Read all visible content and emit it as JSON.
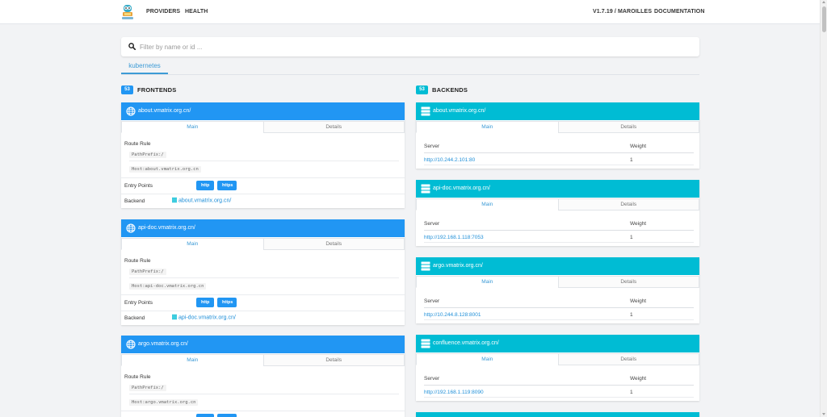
{
  "nav": {
    "links": [
      "PROVIDERS",
      "HEALTH"
    ],
    "version": "V1.7.19 / MAROILLES",
    "documentation": "DOCUMENTATION"
  },
  "search": {
    "placeholder": "Filter by name or id ..."
  },
  "provider_tab": "kubernetes",
  "colors": {
    "frontend": "#2196f3",
    "backend": "#00bcd4",
    "accent": "#3d9bd6"
  },
  "frontends": {
    "count": "53",
    "title": "FRONTENDS",
    "items": [
      {
        "name": "about.vmatrix.org.cn/",
        "tabs": [
          "Main",
          "Details"
        ],
        "route_rule_label": "Route Rule",
        "rules": [
          "PathPrefix:/",
          "Host:about.vmatrix.org.cn"
        ],
        "entry_points_label": "Entry Points",
        "entry_points": [
          "http",
          "https"
        ],
        "backend_label": "Backend",
        "backend": "about.vmatrix.org.cn/"
      },
      {
        "name": "api-doc.vmatrix.org.cn/",
        "tabs": [
          "Main",
          "Details"
        ],
        "route_rule_label": "Route Rule",
        "rules": [
          "PathPrefix:/",
          "Host:api-doc.vmatrix.org.cn"
        ],
        "entry_points_label": "Entry Points",
        "entry_points": [
          "http",
          "https"
        ],
        "backend_label": "Backend",
        "backend": "api-doc.vmatrix.org.cn/"
      },
      {
        "name": "argo.vmatrix.org.cn/",
        "tabs": [
          "Main",
          "Details"
        ],
        "route_rule_label": "Route Rule",
        "rules": [
          "PathPrefix:/",
          "Host:argo.vmatrix.org.cn"
        ]
      }
    ]
  },
  "backends": {
    "count": "53",
    "title": "BACKENDS",
    "items": [
      {
        "name": "about.vmatrix.org.cn/",
        "tabs": [
          "Main",
          "Details"
        ],
        "server_label": "Server",
        "weight_label": "Weight",
        "server": "http://10.244.2.101:80",
        "weight": "1"
      },
      {
        "name": "api-doc.vmatrix.org.cn/",
        "tabs": [
          "Main",
          "Details"
        ],
        "server_label": "Server",
        "weight_label": "Weight",
        "server": "http://192.168.1.118:7053",
        "weight": "1"
      },
      {
        "name": "argo.vmatrix.org.cn/",
        "tabs": [
          "Main",
          "Details"
        ],
        "server_label": "Server",
        "weight_label": "Weight",
        "server": "http://10.244.8.128:8001",
        "weight": "1"
      },
      {
        "name": "confluence.vmatrix.org.cn/",
        "tabs": [
          "Main",
          "Details"
        ],
        "server_label": "Server",
        "weight_label": "Weight",
        "server": "http://192.168.1.119:8090",
        "weight": "1"
      }
    ]
  }
}
